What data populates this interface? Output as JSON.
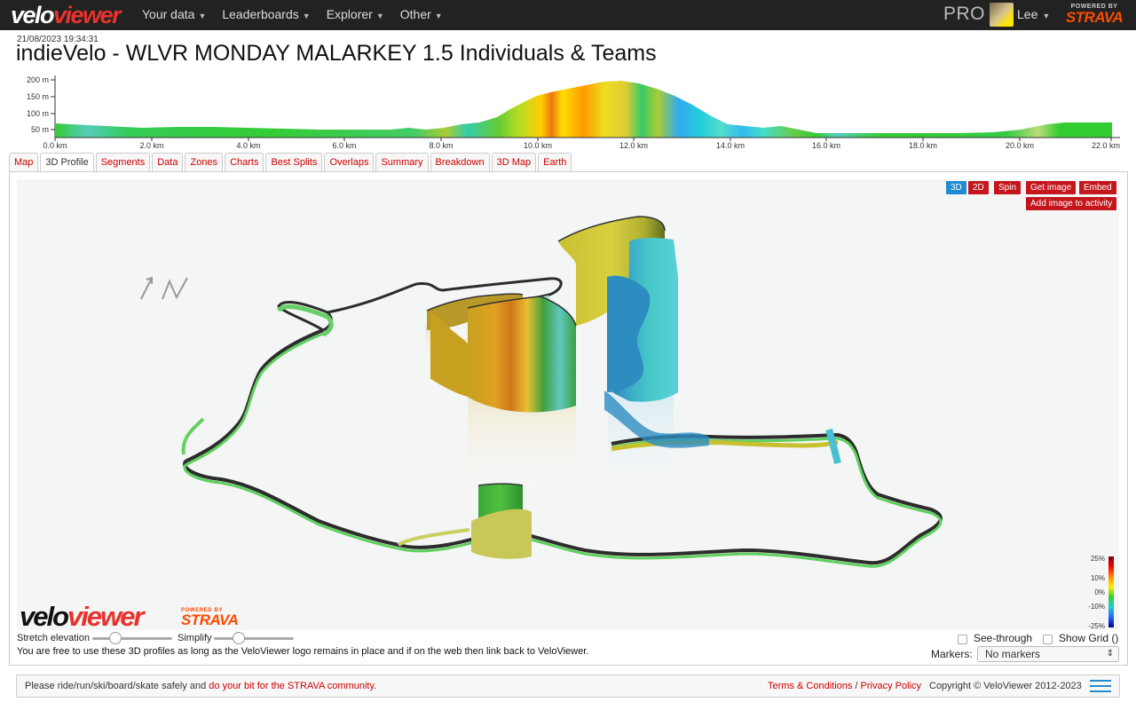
{
  "topbar": {
    "logo_part1": "velo",
    "logo_part2": "viewer",
    "nav": [
      {
        "label": "Your data"
      },
      {
        "label": "Leaderboards"
      },
      {
        "label": "Explorer"
      },
      {
        "label": "Other"
      }
    ],
    "pro": "PRO",
    "user": "Lee",
    "powered_by": "POWERED BY",
    "strava": "STRAVA"
  },
  "activity": {
    "timestamp": "21/08/2023 19:34:31",
    "title": "indieVelo - WLVR MONDAY MALARKEY 1.5 Individuals & Teams"
  },
  "elevation": {
    "y_ticks": [
      "200 m",
      "150 m",
      "100 m",
      "50 m"
    ],
    "x_ticks": [
      "0.0 km",
      "2.0 km",
      "4.0 km",
      "6.0 km",
      "8.0 km",
      "10.0 km",
      "12.0 km",
      "14.0 km",
      "16.0 km",
      "18.0 km",
      "20.0 km",
      "22.0 km"
    ]
  },
  "tabs": [
    {
      "label": "Map",
      "active": false
    },
    {
      "label": "3D Profile",
      "active": true
    },
    {
      "label": "Segments",
      "active": false
    },
    {
      "label": "Data",
      "active": false
    },
    {
      "label": "Zones",
      "active": false
    },
    {
      "label": "Charts",
      "active": false
    },
    {
      "label": "Best Splits",
      "active": false
    },
    {
      "label": "Overlaps",
      "active": false
    },
    {
      "label": "Summary",
      "active": false
    },
    {
      "label": "Breakdown",
      "active": false
    },
    {
      "label": "3D Map",
      "active": false
    },
    {
      "label": "Earth",
      "active": false
    }
  ],
  "viewer": {
    "btn_3d": "3D",
    "btn_2d": "2D",
    "btn_spin": "Spin",
    "btn_get_image": "Get image",
    "btn_embed": "Embed",
    "btn_add_image": "Add image to activity",
    "scale_labels": [
      "25%",
      "10%",
      "0%",
      "-10%",
      "-25%"
    ]
  },
  "bottom_logo": {
    "part1": "velo",
    "part2": "viewer",
    "powered_by": "POWERED BY",
    "strava": "STRAVA"
  },
  "controls": {
    "stretch_label": "Stretch elevation",
    "simplify_label": "Simplify",
    "see_through": "See-through",
    "show_grid": "Show Grid ()",
    "markers_label": "Markers:",
    "markers_value": "No markers",
    "notice": "You are free to use these 3D profiles as long as the VeloViewer logo remains in place and if on the web then link back to VeloViewer."
  },
  "footer": {
    "text_pre": "Please ride/run/ski/board/skate safely and ",
    "text_link": "do your bit for the STRAVA community",
    "text_post": ".",
    "terms": "Terms & Conditions",
    "sep": " / ",
    "privacy": "Privacy Policy",
    "copyright": "Copyright © VeloViewer 2012-2023"
  },
  "colors": {
    "topbar": "#222222",
    "accent_red": "#c4161c",
    "accent_blue": "#1f8bd0",
    "strava_orange": "#fc4c02"
  }
}
